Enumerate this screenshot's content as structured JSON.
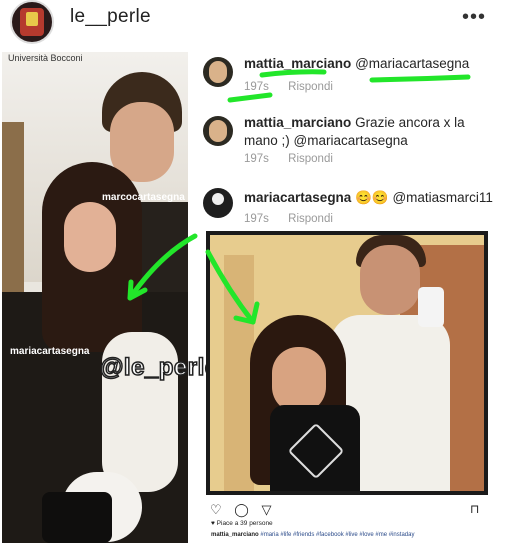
{
  "header": {
    "username": "le__perle",
    "more_label": "•••"
  },
  "left_photo": {
    "location": "Università Bocconi",
    "tag_man": "marcocartasegna",
    "tag_woman": "mariacartasegna",
    "watermark": "@le_perle"
  },
  "comments": [
    {
      "user": "mattia_marciano",
      "text": "@mariacartasegna",
      "time": "197s",
      "reply": "Rispondi"
    },
    {
      "user": "mattia_marciano",
      "text": "Grazie ancora x la",
      "text2": "mano ;) @mariacartasegna",
      "time": "197s",
      "reply": "Rispondi"
    },
    {
      "user": "mariacartasegna",
      "text": "😊😊 @matiasmarci11",
      "time": "197s",
      "reply": "Rispondi"
    }
  ],
  "post": {
    "icons": [
      "heart-icon",
      "comment-icon",
      "share-icon",
      "bookmark-icon"
    ],
    "icon_glyphs": {
      "heart": "♡",
      "comment": "◯",
      "share": "▽",
      "bookmark": "⊓"
    },
    "likes": "♥ Piace a 39 persone",
    "caption_user": "mattia_marciano",
    "caption_tags": "#maria #life #friends #facebook #live #love #me #instaday"
  },
  "colors": {
    "highlight_green": "#22e62a",
    "meta_gray": "#9a9a9a",
    "hashtag_blue": "#2b4b8a"
  }
}
